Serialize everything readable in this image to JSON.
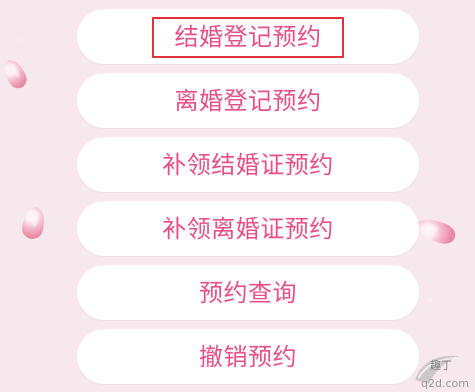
{
  "menu": {
    "items": [
      {
        "label": "结婚登记预约",
        "highlighted": true
      },
      {
        "label": "离婚登记预约",
        "highlighted": false
      },
      {
        "label": "补领结婚证预约",
        "highlighted": false
      },
      {
        "label": "补领离婚证预约",
        "highlighted": false
      },
      {
        "label": "预约查询",
        "highlighted": false
      },
      {
        "label": "撤销预约",
        "highlighted": false
      }
    ]
  },
  "watermark": {
    "site": "q2d.com",
    "brand_glyphs": "趣丁"
  },
  "icons": {
    "decor": [
      "petal-icon"
    ]
  },
  "colors": {
    "background": "#f6e8ec",
    "button_background": "#ffffff",
    "label_pink": "#e74f86",
    "highlight_red": "#e0313d"
  }
}
